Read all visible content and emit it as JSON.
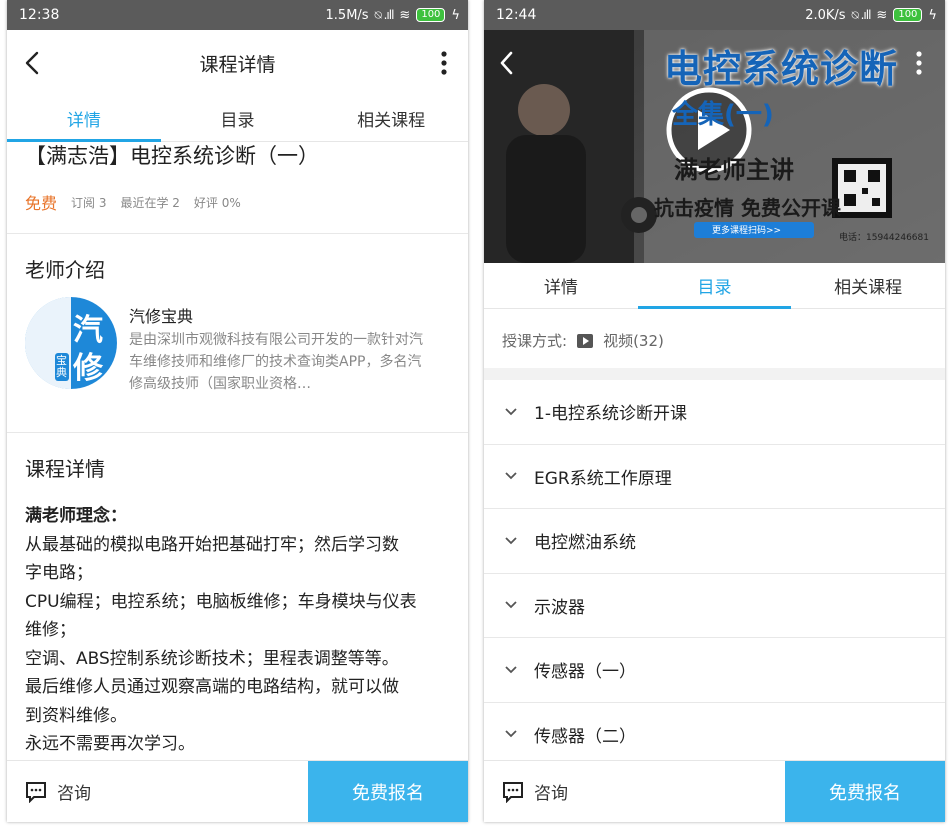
{
  "left": {
    "status": {
      "time": "12:38",
      "speed": "1.5M/s",
      "battery": "100"
    },
    "header": {
      "title": "课程详情"
    },
    "tabs": [
      {
        "label": "详情"
      },
      {
        "label": "目录"
      },
      {
        "label": "相关课程"
      }
    ],
    "course": {
      "title": "【满志浩】电控系统诊断（一）",
      "price": "免费",
      "subscriptions": "订阅 3",
      "recent": "最近在学 2",
      "rating": "好评 0%"
    },
    "teacher": {
      "section_title": "老师介绍",
      "name": "汽修宝典",
      "description": "是由深圳市观微科技有限公司开发的一款针对汽车维修技师和维修厂的技术查询类APP，多名汽修高级技师（国家职业资格…",
      "avatar_text_top": "汽",
      "avatar_text_bottom": "修",
      "avatar_side": "宝典"
    },
    "details": {
      "section_title": "课程详情",
      "heading": "满老师理念：",
      "lines": [
        "从最基础的模拟电路开始把基础打牢；然后学习数",
        "字电路；",
        "CPU编程；电控系统；电脑板维修；车身模块与仪表",
        "维修；",
        "空调、ABS控制系统诊断技术；里程表调整等等。",
        "最后维修人员通过观察高端的电路结构，就可以做",
        "到资料维修。",
        "永远不需要再次学习。"
      ]
    },
    "bottom": {
      "consult": "咨询",
      "enroll": "免费报名"
    }
  },
  "right": {
    "status": {
      "time": "12:44",
      "speed": "2.0K/s",
      "battery": "100"
    },
    "video": {
      "banner": "电控系统诊断",
      "sub": "全集(一)",
      "host": "满老师主讲",
      "slogan": "抗击疫情  免费公开课",
      "more": "更多课程扫码>>",
      "phone": "电话：15944246681"
    },
    "tabs": [
      {
        "label": "详情"
      },
      {
        "label": "目录"
      },
      {
        "label": "相关课程"
      }
    ],
    "teach_mode": {
      "label": "授课方式:",
      "value": "视频(32)"
    },
    "chapters": [
      {
        "label": "1-电控系统诊断开课"
      },
      {
        "label": "EGR系统工作原理"
      },
      {
        "label": "电控燃油系统"
      },
      {
        "label": "示波器"
      },
      {
        "label": "传感器（一）"
      },
      {
        "label": "传感器（二）"
      }
    ],
    "bottom": {
      "consult": "咨询",
      "enroll": "免费报名"
    }
  },
  "colors": {
    "accent": "#21a5e5",
    "enroll": "#3bb4ec",
    "free": "#e8742a",
    "status_bar": "#5b5b5b"
  }
}
